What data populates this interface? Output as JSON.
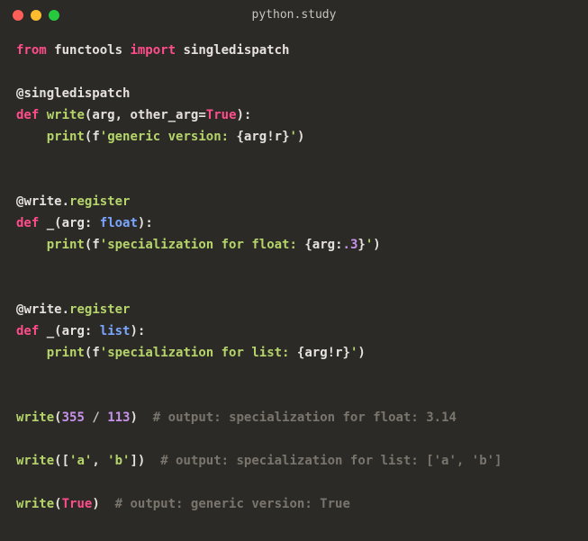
{
  "window": {
    "title": "python.study"
  },
  "code": {
    "lines": [
      {
        "t": "import",
        "from": "from",
        "mod": "functools",
        "import": "import",
        "name": "singledispatch"
      },
      {
        "t": "blank"
      },
      {
        "t": "deco",
        "at": "@",
        "name": "singledispatch"
      },
      {
        "t": "def",
        "kw": "def",
        "fn": "write",
        "open": "(",
        "p1": "arg",
        "c1": ", ",
        "p2": "other_arg",
        "eq": "=",
        "val": "True",
        "close": "):"
      },
      {
        "t": "print",
        "indent": "    ",
        "fn": "print",
        "open": "(",
        "fpref": "f",
        "q1": "'",
        "str": "generic version: ",
        "ibr1": "{",
        "ivar": "arg",
        "iconv": "!r",
        "ibr2": "}",
        "q2": "'",
        "close": ")"
      },
      {
        "t": "blank"
      },
      {
        "t": "blank"
      },
      {
        "t": "deco2",
        "at": "@",
        "obj": "write",
        "dot": ".",
        "attr": "register"
      },
      {
        "t": "def2",
        "kw": "def",
        "fn": "_",
        "open": "(",
        "p": "arg",
        "colon": ": ",
        "type": "float",
        "close": "):"
      },
      {
        "t": "print2",
        "indent": "    ",
        "fn": "print",
        "open": "(",
        "fpref": "f",
        "q1": "'",
        "str": "specialization for float: ",
        "ibr1": "{",
        "ivar": "arg",
        "ifmt": ":",
        "ifmtv": ".3",
        "ibr2": "}",
        "q2": "'",
        "close": ")"
      },
      {
        "t": "blank"
      },
      {
        "t": "blank"
      },
      {
        "t": "deco2",
        "at": "@",
        "obj": "write",
        "dot": ".",
        "attr": "register"
      },
      {
        "t": "def2",
        "kw": "def",
        "fn": "_",
        "open": "(",
        "p": "arg",
        "colon": ": ",
        "type": "list",
        "close": "):"
      },
      {
        "t": "print",
        "indent": "    ",
        "fn": "print",
        "open": "(",
        "fpref": "f",
        "q1": "'",
        "str": "specialization for list: ",
        "ibr1": "{",
        "ivar": "arg",
        "iconv": "!r",
        "ibr2": "}",
        "q2": "'",
        "close": ")"
      },
      {
        "t": "blank"
      },
      {
        "t": "blank"
      },
      {
        "t": "call1",
        "fn": "write",
        "open": "(",
        "n1": "355",
        "op": " / ",
        "n2": "113",
        "close": ")",
        "gap": "  ",
        "comment": "# output: specialization for float: 3.14"
      },
      {
        "t": "blank"
      },
      {
        "t": "call2",
        "fn": "write",
        "open": "([",
        "s1": "'a'",
        "c": ", ",
        "s2": "'b'",
        "close": "])",
        "gap": "  ",
        "comment": "# output: specialization for list: ['a', 'b']"
      },
      {
        "t": "blank"
      },
      {
        "t": "call3",
        "fn": "write",
        "open": "(",
        "val": "True",
        "close": ")",
        "gap": "  ",
        "comment": "# output: generic version: True"
      }
    ]
  }
}
